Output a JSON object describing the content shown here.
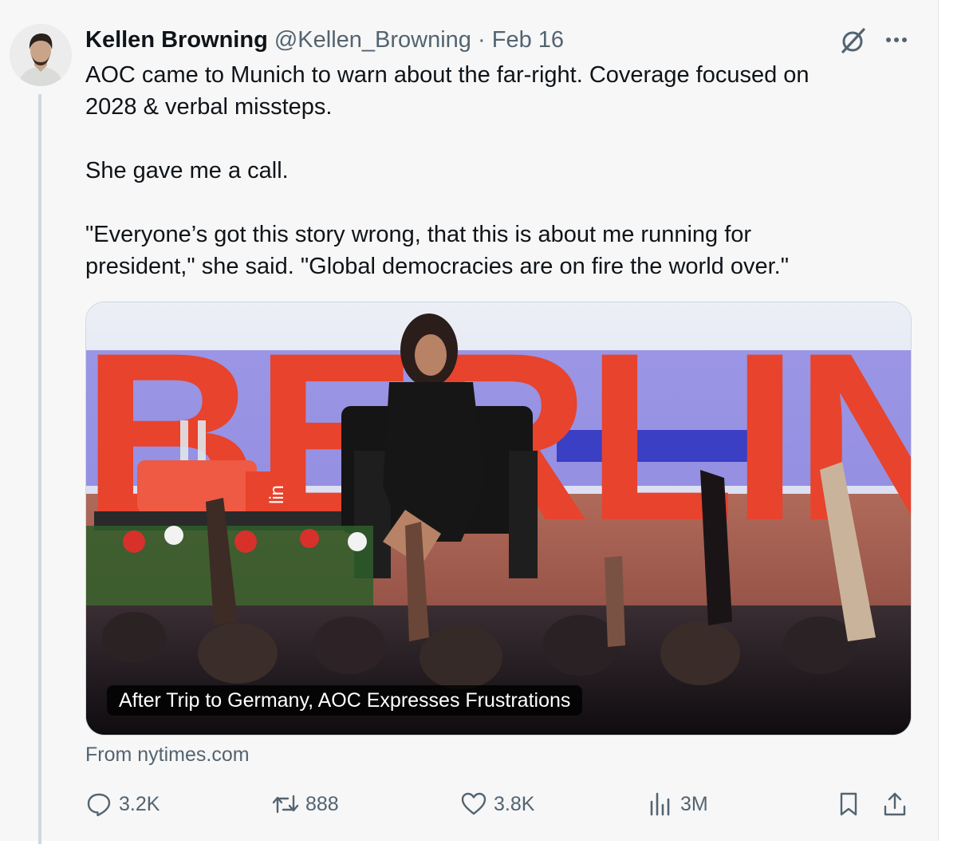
{
  "tweet": {
    "author_name": "Kellen Browning",
    "handle": "@Kellen_Browning",
    "separator": "·",
    "date": "Feb 16",
    "text": "AOC came to Munich to warn about the far-right. Coverage focused on\n2028 & verbal missteps.\n\nShe gave me a call.\n\n\"Everyone’s got this story wrong, that this is about me running for\npresident,\" she said. \"Global democracies are on fire the world over.\""
  },
  "media": {
    "caption": "After Trip to Germany, AOC Expresses Frustrations",
    "source": "From nytimes.com",
    "backdrop_letters": "BERLIN",
    "podium_text": "lin"
  },
  "actions": {
    "replies": "3.2K",
    "reposts": "888",
    "likes": "3.8K",
    "views": "3M"
  },
  "icons": {
    "header": [
      "grok-icon",
      "more-icon"
    ],
    "actions": [
      "reply-icon",
      "repost-icon",
      "like-icon",
      "views-icon",
      "bookmark-icon",
      "share-icon"
    ]
  },
  "colors": {
    "text": "#0f1419",
    "secondary": "#536471",
    "background": "#f7f7f7",
    "thread_line": "#cfd9de",
    "stage_red": "#e8432c"
  }
}
